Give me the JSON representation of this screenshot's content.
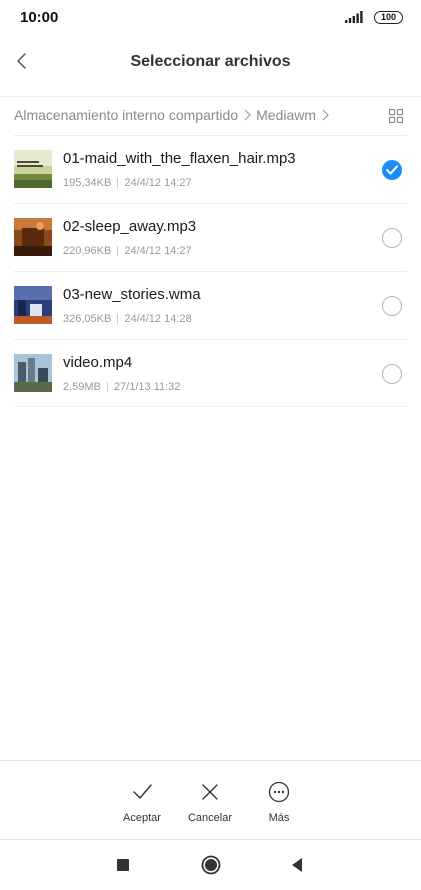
{
  "status_bar": {
    "time": "10:00",
    "battery": "100"
  },
  "header": {
    "title": "Seleccionar archivos",
    "back_icon": "chevron-left-icon"
  },
  "breadcrumb": {
    "items": [
      "Almacenamiento interno compartido",
      "Mediawm"
    ],
    "view_icon": "grid-view-icon"
  },
  "files": [
    {
      "name": "01-maid_with_the_flaxen_hair.mp3",
      "size": "195,34KB",
      "date": "24/4/12 14:27",
      "selected": true
    },
    {
      "name": "02-sleep_away.mp3",
      "size": "220,96KB",
      "date": "24/4/12 14:27",
      "selected": false
    },
    {
      "name": "03-new_stories.wma",
      "size": "326,05KB",
      "date": "24/4/12 14:28",
      "selected": false
    },
    {
      "name": "video.mp4",
      "size": "2,59MB",
      "date": "27/1/13 11:32",
      "selected": false
    }
  ],
  "actions": {
    "accept": "Aceptar",
    "cancel": "Cancelar",
    "more": "Más"
  },
  "colors": {
    "accent": "#1a8ef5"
  }
}
